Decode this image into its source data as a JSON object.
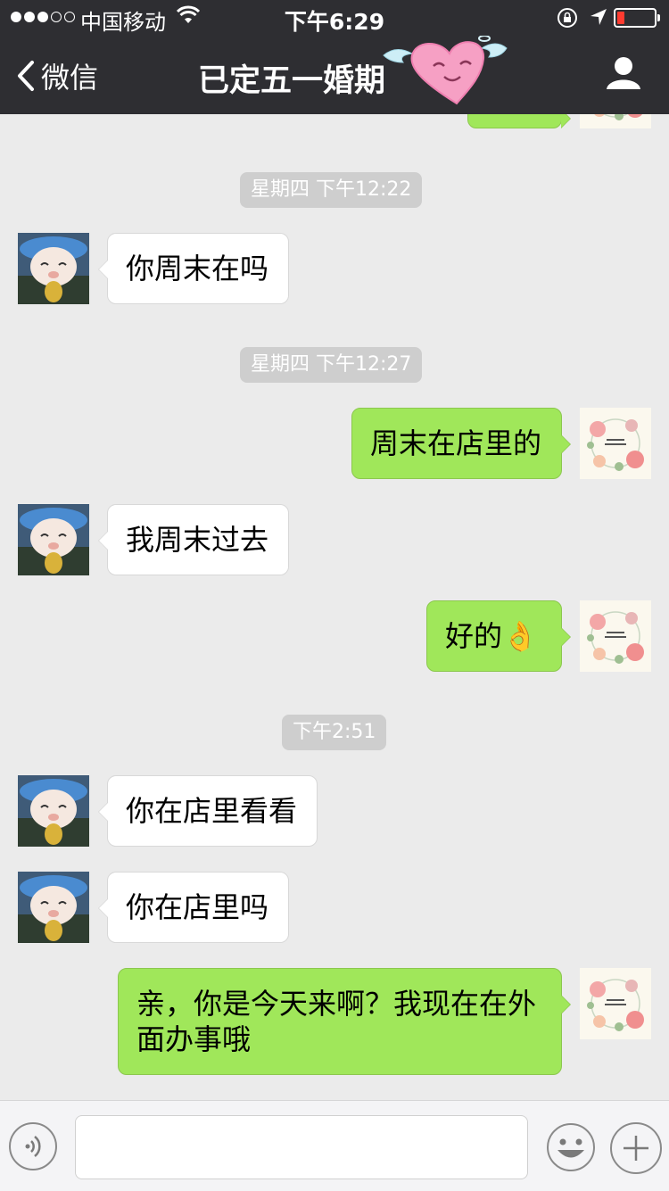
{
  "status_bar": {
    "carrier": "中国移动",
    "time": "下午6:29",
    "battery_level": 0.15
  },
  "nav": {
    "back_label": "微信",
    "title": "已定五一婚期"
  },
  "messages": [
    {
      "type": "timestamp",
      "text": "星期四 下午12:22"
    },
    {
      "type": "incoming",
      "text": "你周末在吗"
    },
    {
      "type": "timestamp",
      "text": "星期四 下午12:27"
    },
    {
      "type": "outgoing",
      "text": "周末在店里的"
    },
    {
      "type": "incoming",
      "text": "我周末过去"
    },
    {
      "type": "outgoing",
      "text": "好的👌"
    },
    {
      "type": "timestamp",
      "text": "下午2:51"
    },
    {
      "type": "incoming",
      "text": "你在店里看看"
    },
    {
      "type": "incoming",
      "text": "你在店里吗"
    },
    {
      "type": "outgoing",
      "text": "亲，你是今天来啊？我现在在外面办事哦"
    }
  ],
  "input": {
    "value": ""
  },
  "colors": {
    "outgoing_bubble": "#a0e75a",
    "header": "#2e2e32",
    "background": "#ebebeb"
  }
}
